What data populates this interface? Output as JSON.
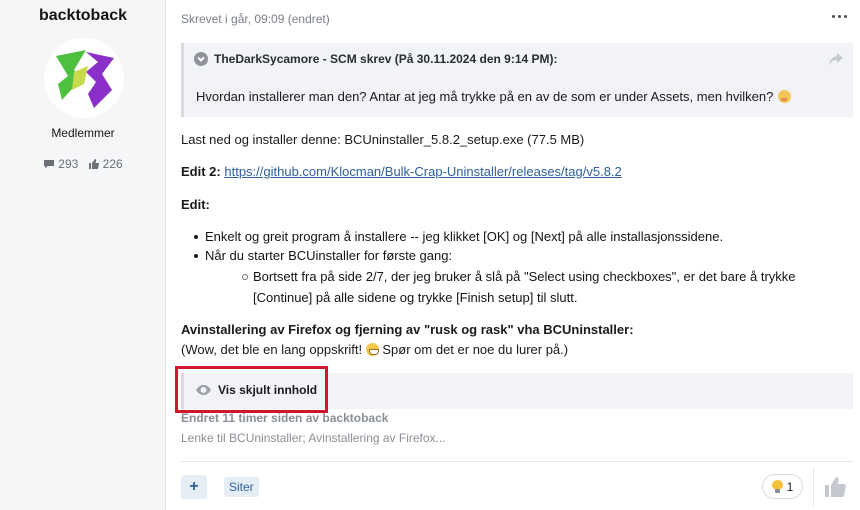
{
  "user": {
    "name": "backtoback",
    "role": "Medlemmer",
    "messages_count": "293",
    "reactions_count": "226",
    "avatar_colors": [
      "#4fbf3f",
      "#8b2fc9"
    ]
  },
  "post": {
    "date": "Skrevet i går, 09:09 (endret)",
    "quote": {
      "author_line": "TheDarkSycamore - SCM skrev (På 30.11.2024 den 9:14 PM):",
      "body": "Hvordan installerer man den? Antar at jeg må trykke på en av de som er under Assets, men hvilken?"
    },
    "line_download": "Last ned og installer denne: BCUninstaller_5.8.2_setup.exe (77.5 MB)",
    "edit2_label": "Edit 2:",
    "edit2_link": "https://github.com/Klocman/Bulk-Crap-Uninstaller/releases/tag/v5.8.2",
    "edit_label": "Edit:",
    "bullets": [
      "Enkelt og greit program å installere -- jeg klikket [OK] og [Next] på alle installasjonssidene.",
      "Når du starter BCUinstaller for første gang:"
    ],
    "subbullet_lines": [
      "Bortsett fra på side 2/7, der jeg bruker å slå på \"Select using checkboxes\", er det bare å trykke",
      "[Continue] på alle sidene og trykke [Finish setup] til slutt."
    ],
    "uninstall_heading": "Avinstallering av Firefox og fjerning av \"rusk og rask\" vha BCUninstaller:",
    "uninstall_note_before": "(Wow, det ble en lang oppskrift!",
    "uninstall_note_after": "Spør om det er noe du lurer på.)",
    "spoiler_label": "Vis skjult innhold",
    "edited_note": "Endret 11 timer siden av backtoback",
    "signature": "Lenke til BCUninstaller; Avinstallering av Firefox..."
  },
  "footer": {
    "plus_label": "+",
    "quote_label": "Siter",
    "reaction_count": "1"
  },
  "icons": {
    "more": "more-horizontal-icon",
    "quote_toggle": "chevron-down-icon",
    "share": "share-arrow-icon",
    "spoiler": "eye-icon",
    "reaction": "lightbulb-icon",
    "like": "thumbs-up-icon"
  },
  "colors": {
    "link": "#2e5f9e",
    "highlight_border": "#d0162a",
    "sidebar_bg": "#f5f6f8"
  }
}
